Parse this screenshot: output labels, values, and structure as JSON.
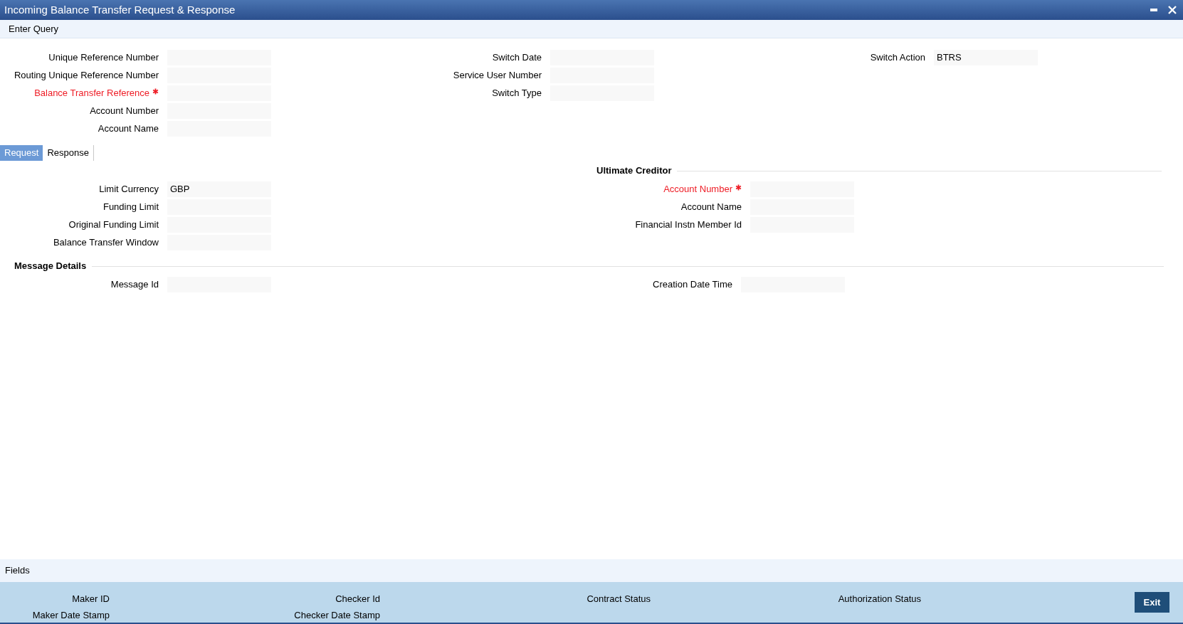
{
  "window": {
    "title": "Incoming Balance Transfer Request & Response"
  },
  "menu": [
    {
      "label": "Enter Query"
    }
  ],
  "header_columns": [
    {
      "fields": [
        {
          "label": "Unique Reference Number",
          "required": false
        },
        {
          "label": "Routing Unique Reference Number",
          "required": false
        },
        {
          "label": "Balance Transfer Reference",
          "required": true
        },
        {
          "label": "Account Number",
          "required": false
        },
        {
          "label": "Account Name",
          "required": false
        }
      ]
    },
    {
      "fields": [
        {
          "label": "Switch Date",
          "required": false
        },
        {
          "label": "Service User Number",
          "required": false
        },
        {
          "label": "Switch Type",
          "required": false
        }
      ]
    },
    {
      "fields": [
        {
          "label": "Switch Action",
          "value": "BTRS",
          "required": false
        }
      ]
    }
  ],
  "tabs": [
    {
      "label": "Request",
      "selected": true
    },
    {
      "label": "Response",
      "selected": false
    }
  ],
  "request": {
    "fields": [
      {
        "label": "Limit Currency",
        "value": "GBP",
        "required": false
      },
      {
        "label": "Funding Limit",
        "required": false
      },
      {
        "label": "Original Funding Limit",
        "required": false
      },
      {
        "label": "Balance Transfer Window",
        "required": false
      }
    ],
    "ultimate_creditor": {
      "title": "Ultimate Creditor",
      "fields": [
        {
          "label": "Account Number",
          "required": true
        },
        {
          "label": "Account Name",
          "required": false
        },
        {
          "label": "Financial Instn Member Id",
          "required": false
        }
      ]
    },
    "message_details": {
      "title": "Message Details",
      "fields": [
        {
          "label": "Message Id",
          "required": false
        },
        {
          "label": "Creation Date Time",
          "required": false
        }
      ]
    }
  },
  "footer": {
    "fields_label": "Fields",
    "audit_columns": [
      [
        "Maker ID",
        "Maker Date Stamp"
      ],
      [
        "Checker Id",
        "Checker Date Stamp"
      ],
      [
        "Contract Status"
      ],
      [
        "Authorization Status"
      ]
    ],
    "exit_button": "Exit"
  }
}
